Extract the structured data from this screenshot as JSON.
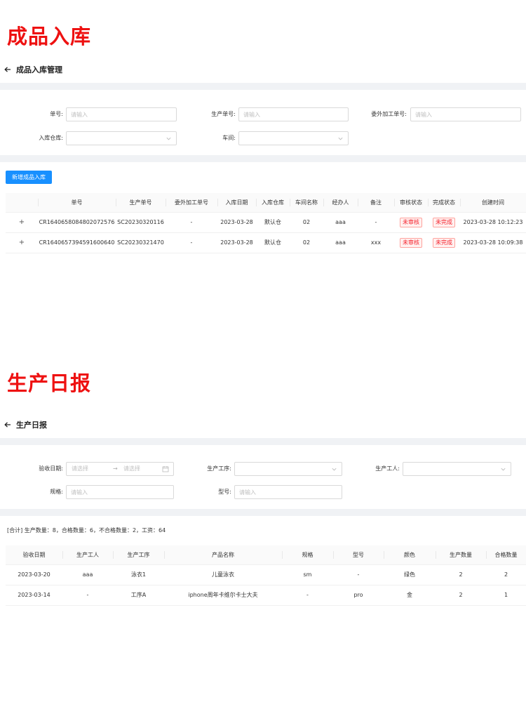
{
  "section1": {
    "big_title": "成品入库",
    "page_title": "成品入库管理",
    "filters": {
      "order_no_label": "单号:",
      "order_no_placeholder": "请输入",
      "production_no_label": "生产单号:",
      "production_no_placeholder": "请输入",
      "outsource_no_label": "委外加工单号:",
      "outsource_no_placeholder": "请输入",
      "warehouse_label": "入库仓库:",
      "workshop_label": "车间:"
    },
    "new_button": "新增成品入库",
    "table": {
      "columns": [
        "",
        "单号",
        "生产单号",
        "委外加工单号",
        "入库日期",
        "入库仓库",
        "车间名称",
        "经办人",
        "备注",
        "审核状态",
        "完成状态",
        "创建时间"
      ],
      "rows": [
        {
          "expand": "+",
          "order_no": "CR1640658084802072576",
          "production_no": "SC20230320116",
          "outsource_no": "-",
          "date": "2023-03-28",
          "warehouse": "默认仓",
          "workshop": "02",
          "handler": "aaa",
          "remark": "-",
          "audit_status": "未审核",
          "finish_status": "未完成",
          "created": "2023-03-28 10:12:23"
        },
        {
          "expand": "+",
          "order_no": "CR1640657394591600640",
          "production_no": "SC20230321470",
          "outsource_no": "-",
          "date": "2023-03-28",
          "warehouse": "默认仓",
          "workshop": "02",
          "handler": "aaa",
          "remark": "xxx",
          "audit_status": "未审核",
          "finish_status": "未完成",
          "created": "2023-03-28 10:09:38"
        }
      ]
    }
  },
  "section2": {
    "big_title": "生产日报",
    "page_title": "生产日报",
    "filters": {
      "date_label": "验收日期:",
      "date_start_placeholder": "请选择",
      "date_separator": "→",
      "date_end_placeholder": "请选择",
      "process_label": "生产工序:",
      "worker_label": "生产工人:",
      "spec_label": "规格:",
      "spec_placeholder": "请输入",
      "model_label": "型号:",
      "model_placeholder": "请输入"
    },
    "summary": "[合计] 生产数量：8，合格数量：6，不合格数量：2，工资：64",
    "table": {
      "columns": [
        "验收日期",
        "生产工人",
        "生产工序",
        "产品名称",
        "规格",
        "型号",
        "颜色",
        "生产数量",
        "合格数量"
      ],
      "rows": [
        {
          "date": "2023-03-20",
          "worker": "aaa",
          "process": "泳衣1",
          "product": "儿童泳衣",
          "spec": "sm",
          "model": "-",
          "color": "绿色",
          "qty": "2",
          "qualified": "2"
        },
        {
          "date": "2023-03-14",
          "worker": "-",
          "process": "工序A",
          "product": "iphone周年卡维尔卡士大夫",
          "spec": "-",
          "model": "pro",
          "color": "金",
          "qty": "2",
          "qualified": "1"
        }
      ]
    }
  }
}
